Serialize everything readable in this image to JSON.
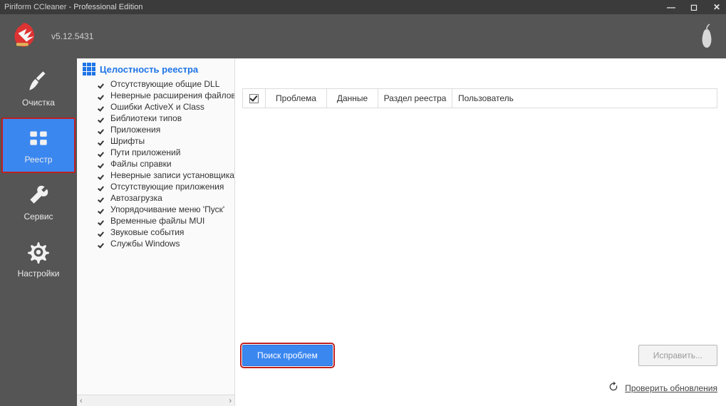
{
  "titlebar": {
    "app": "Piriform CCleaner",
    "edition": "Professional Edition"
  },
  "version": "v5.12.5431",
  "nav": {
    "clean": "Очистка",
    "registry": "Реестр",
    "tools": "Сервис",
    "options": "Настройки"
  },
  "panel": {
    "title": "Целостность реестра",
    "items": [
      "Отсутствующие общие DLL",
      "Неверные расширения файлов",
      "Ошибки ActiveX и Class",
      "Библиотеки типов",
      "Приложения",
      "Шрифты",
      "Пути приложений",
      "Файлы справки",
      "Неверные записи установщика",
      "Отсутствующие приложения",
      "Автозагрузка",
      "Упорядочивание меню 'Пуск'",
      "Временные файлы MUI",
      "Звуковые события",
      "Службы Windows"
    ]
  },
  "table": {
    "cols": {
      "problem": "Проблема",
      "data": "Данные",
      "section": "Раздел реестра",
      "user": "Пользователь"
    }
  },
  "buttons": {
    "scan": "Поиск проблем",
    "fix": "Исправить..."
  },
  "footer": {
    "update": "Проверить обновления"
  }
}
